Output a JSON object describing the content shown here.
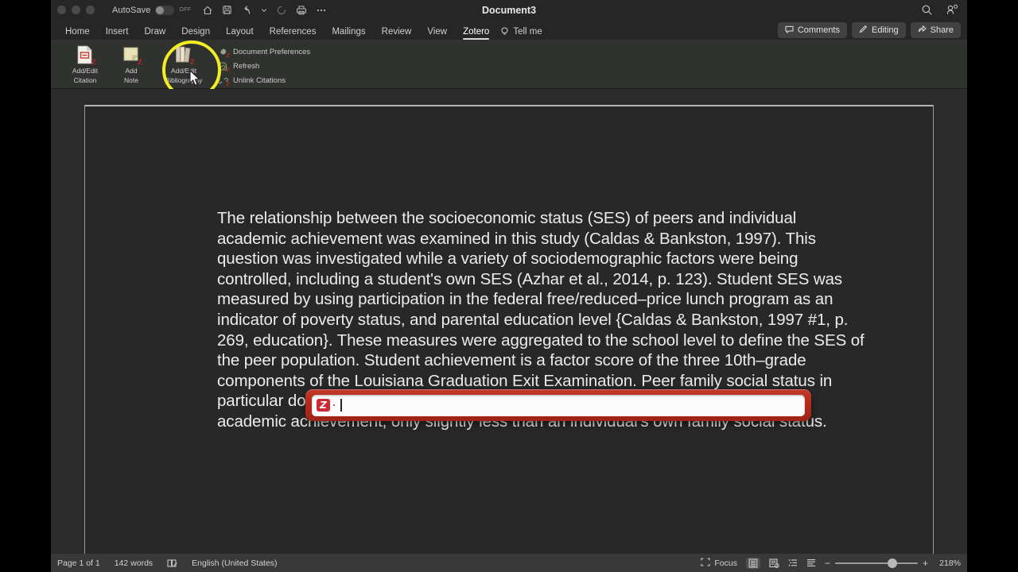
{
  "titlebar": {
    "autosave_label": "AutoSave",
    "autosave_state": "OFF",
    "document_title": "Document3",
    "quick_access": [
      {
        "name": "home-icon",
        "label": "Home"
      },
      {
        "name": "save-icon",
        "label": "Save"
      },
      {
        "name": "undo-icon",
        "label": "Undo"
      },
      {
        "name": "undo-dropdown-icon",
        "label": "Undo options"
      },
      {
        "name": "redo-icon",
        "label": "Redo"
      },
      {
        "name": "print-icon",
        "label": "Print"
      },
      {
        "name": "more-icon",
        "label": "More"
      }
    ],
    "right_icons": [
      {
        "name": "search-icon",
        "label": "Search"
      },
      {
        "name": "account-icon",
        "label": "Account"
      }
    ]
  },
  "ribbon_tabs": {
    "items": [
      {
        "label": "Home",
        "active": false
      },
      {
        "label": "Insert",
        "active": false
      },
      {
        "label": "Draw",
        "active": false
      },
      {
        "label": "Design",
        "active": false
      },
      {
        "label": "Layout",
        "active": false
      },
      {
        "label": "References",
        "active": false
      },
      {
        "label": "Mailings",
        "active": false
      },
      {
        "label": "Review",
        "active": false
      },
      {
        "label": "View",
        "active": false
      },
      {
        "label": "Zotero",
        "active": true
      }
    ],
    "tell_me": "Tell me",
    "actions": [
      {
        "label": "Comments",
        "icon": "comment-icon"
      },
      {
        "label": "Editing",
        "icon": "pencil-icon"
      },
      {
        "label": "Share",
        "icon": "share-icon"
      }
    ]
  },
  "ribbon": {
    "buttons": [
      {
        "label_line1": "Add/Edit",
        "label_line2": "Citation",
        "icon": "add-edit-citation-icon"
      },
      {
        "label_line1": "Add",
        "label_line2": "Note",
        "icon": "add-note-icon"
      },
      {
        "label_line1": "Add/Edit",
        "label_line2": "Bibliography",
        "icon": "add-edit-bibliography-icon"
      }
    ],
    "menu_items": [
      {
        "label": "Document Preferences",
        "icon": "document-preferences-icon"
      },
      {
        "label": "Refresh",
        "icon": "refresh-icon"
      },
      {
        "label": "Unlink Citations",
        "icon": "unlink-citations-icon"
      }
    ]
  },
  "document": {
    "body": "The relationship between the socioeconomic status (SES) of peers and individual academic achievement was examined in this study (Caldas & Bankston, 1997). This question was investigated while a variety of sociodemographic factors were being controlled, including a student's own SES (Azhar et al., 2014, p. 123). Student SES was measured by using participation in the federal free/reduced–price lunch program as an indicator of poverty status, and parental education level {Caldas & Bankston, 1997 #1, p. 269, education}. These measures were aggregated to the school level to define the SES of the peer population. Student achievement is a factor score of the three 10th–grade components of the Louisiana Graduation Exit Examination. Peer family social status in particular does have a significant and substantive independent effect on individual academic achievement, only slightly less than an individual's own family social status."
  },
  "zotero_dialog": {
    "logo_text": "Z",
    "input_value": "",
    "input_placeholder": ""
  },
  "statusbar": {
    "page": "Page 1 of 1",
    "words": "142 words",
    "proofing_icon": "proofing-icon",
    "language": "English (United States)",
    "focus_label": "Focus",
    "view_icons": [
      {
        "name": "print-layout-icon",
        "selected": true
      },
      {
        "name": "web-layout-icon",
        "selected": false
      },
      {
        "name": "outline-view-icon",
        "selected": false
      },
      {
        "name": "draft-view-icon",
        "selected": false
      }
    ],
    "zoom_minus": "−",
    "zoom_plus": "+",
    "zoom_value": "218%"
  },
  "colors": {
    "accent_red": "#b22a1c",
    "highlight_yellow": "#f2ee23",
    "window_bg": "#2b2b2b",
    "ribbon_bg": "#2f322f"
  }
}
